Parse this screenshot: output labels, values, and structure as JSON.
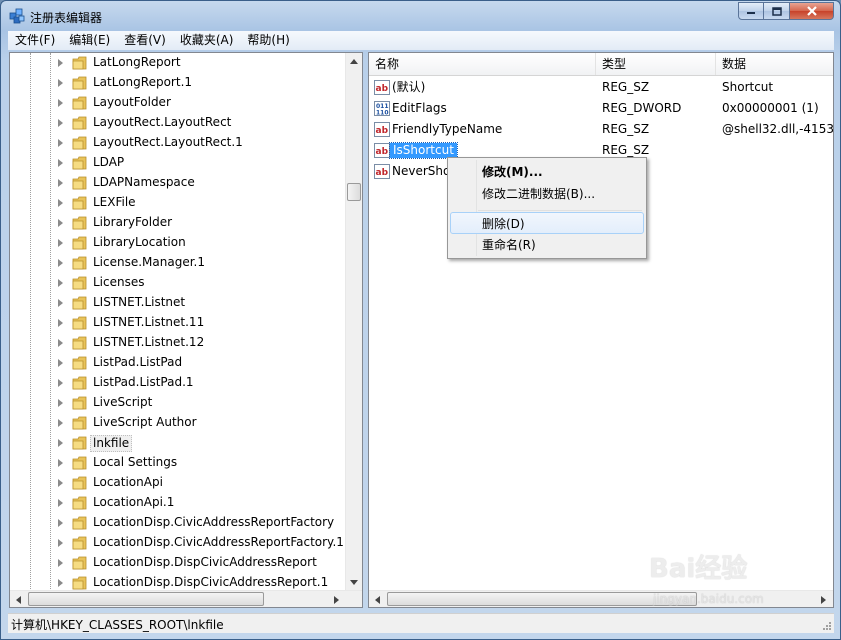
{
  "window": {
    "title": "注册表编辑器",
    "buttons": {
      "minimize": "minimize",
      "maximize": "maximize",
      "close": "close"
    }
  },
  "menubar": {
    "items": [
      "文件(F)",
      "编辑(E)",
      "查看(V)",
      "收藏夹(A)",
      "帮助(H)"
    ]
  },
  "tree": {
    "items": [
      {
        "label": "LatLongReport"
      },
      {
        "label": "LatLongReport.1"
      },
      {
        "label": "LayoutFolder"
      },
      {
        "label": "LayoutRect.LayoutRect"
      },
      {
        "label": "LayoutRect.LayoutRect.1"
      },
      {
        "label": "LDAP"
      },
      {
        "label": "LDAPNamespace"
      },
      {
        "label": "LEXFile"
      },
      {
        "label": "LibraryFolder"
      },
      {
        "label": "LibraryLocation"
      },
      {
        "label": "License.Manager.1"
      },
      {
        "label": "Licenses"
      },
      {
        "label": "LISTNET.Listnet"
      },
      {
        "label": "LISTNET.Listnet.11"
      },
      {
        "label": "LISTNET.Listnet.12"
      },
      {
        "label": "ListPad.ListPad"
      },
      {
        "label": "ListPad.ListPad.1"
      },
      {
        "label": "LiveScript"
      },
      {
        "label": "LiveScript Author"
      },
      {
        "label": "lnkfile",
        "selected": true
      },
      {
        "label": "Local Settings"
      },
      {
        "label": "LocationApi"
      },
      {
        "label": "LocationApi.1"
      },
      {
        "label": "LocationDisp.CivicAddressReportFactory"
      },
      {
        "label": "LocationDisp.CivicAddressReportFactory.1"
      },
      {
        "label": "LocationDisp.DispCivicAddressReport"
      },
      {
        "label": "LocationDisp.DispCivicAddressReport.1"
      }
    ]
  },
  "list": {
    "columns": {
      "name": "名称",
      "type": "类型",
      "data": "数据"
    },
    "rows": [
      {
        "icon": "string-value-icon",
        "name": "(默认)",
        "type": "REG_SZ",
        "data": "Shortcut"
      },
      {
        "icon": "binary-value-icon",
        "name": "EditFlags",
        "type": "REG_DWORD",
        "data": "0x00000001 (1)"
      },
      {
        "icon": "string-value-icon",
        "name": "FriendlyTypeName",
        "type": "REG_SZ",
        "data": "@shell32.dll,-4153"
      },
      {
        "icon": "string-value-icon",
        "name": "IsShortcut",
        "type": "REG_SZ",
        "data": "",
        "selected": true
      },
      {
        "icon": "string-value-icon",
        "name": "NeverSho",
        "type": "",
        "data": ""
      }
    ]
  },
  "context_menu": {
    "items": [
      {
        "label": "修改(M)...",
        "bold": true
      },
      {
        "label": "修改二进制数据(B)..."
      },
      {
        "label": "删除(D)",
        "hover": true
      },
      {
        "label": "重命名(R)"
      }
    ]
  },
  "status": {
    "path": "计算机\\HKEY_CLASSES_ROOT\\lnkfile"
  },
  "watermark": {
    "brand": "Bai经验",
    "url": "jingyan.baidu.com"
  }
}
